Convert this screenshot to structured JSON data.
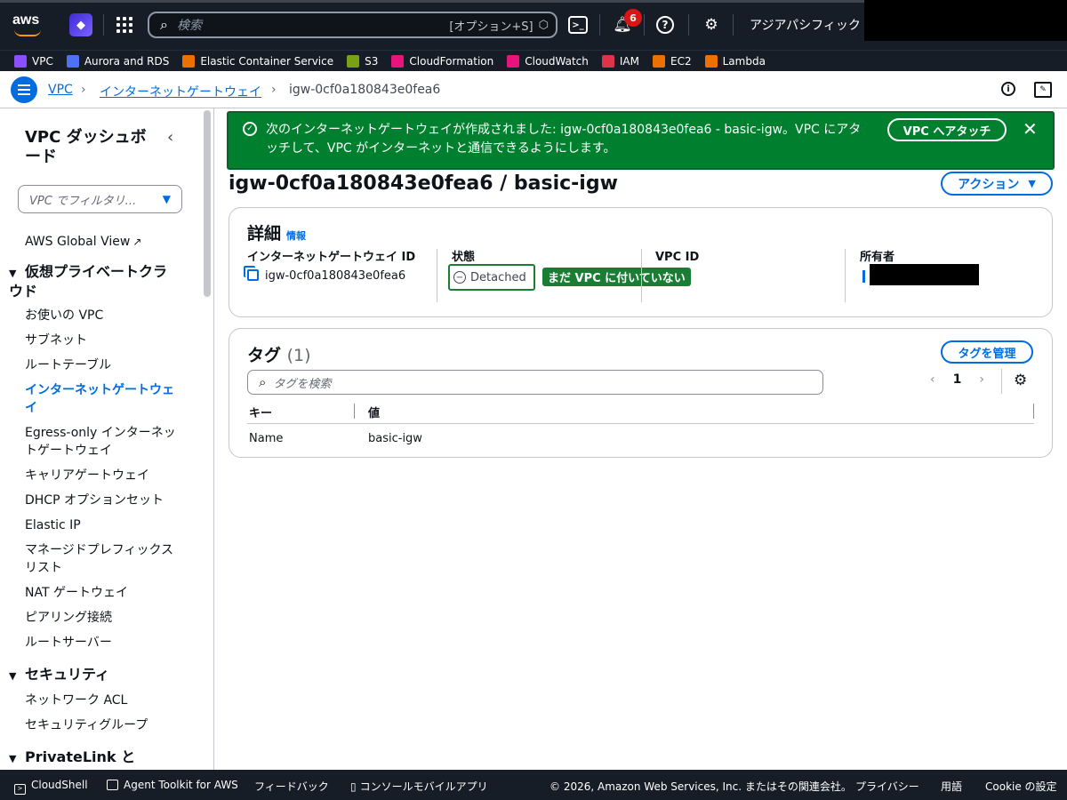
{
  "topnav": {
    "logo": "aws",
    "search_placeholder": "検索",
    "search_shortcut": "[オプション+S]",
    "notification_count": "6",
    "region": "アジアパシフィック (東京)"
  },
  "favorites": [
    {
      "label": "VPC",
      "color": "#8c4fff"
    },
    {
      "label": "Aurora and RDS",
      "color": "#4d72f3"
    },
    {
      "label": "Elastic Container Service",
      "color": "#ed7100"
    },
    {
      "label": "S3",
      "color": "#7aa116"
    },
    {
      "label": "CloudFormation",
      "color": "#e7157b"
    },
    {
      "label": "CloudWatch",
      "color": "#e7157b"
    },
    {
      "label": "IAM",
      "color": "#dd344c"
    },
    {
      "label": "EC2",
      "color": "#ed7100"
    },
    {
      "label": "Lambda",
      "color": "#ed7100"
    }
  ],
  "breadcrumb": {
    "items": [
      "VPC",
      "インターネットゲートウェイ"
    ],
    "current": "igw-0cf0a180843e0fea6"
  },
  "sidebar": {
    "title": "VPC ダッシュボード",
    "filter_placeholder": "VPC でフィルタリ...",
    "global_view": "AWS Global View",
    "section_vpc": "仮想プライベートクラウド",
    "vpc_items": [
      "お使いの VPC",
      "サブネット",
      "ルートテーブル",
      "インターネットゲートウェイ",
      "Egress-only インターネットゲートウェイ",
      "キャリアゲートウェイ",
      "DHCP オプションセット",
      "Elastic IP",
      "マネージドプレフィックスリスト",
      "NAT ゲートウェイ",
      "ピアリング接続",
      "ルートサーバー"
    ],
    "section_security": "セキュリティ",
    "security_items": [
      "ネットワーク ACL",
      "セキュリティグループ"
    ],
    "section_privatelink": "PrivateLink と Lattice"
  },
  "flash": {
    "message": "次のインターネットゲートウェイが作成されました: igw-0cf0a180843e0fea6 - basic-igw。VPC にアタッチして、VPC がインターネットと通信できるようにします。",
    "attach_button": "VPC へアタッチ"
  },
  "page": {
    "title": "igw-0cf0a180843e0fea6 / basic-igw",
    "actions_button": "アクション"
  },
  "details": {
    "heading": "詳細",
    "info_link": "情報",
    "igw_id_label": "インターネットゲートウェイ ID",
    "igw_id_value": "igw-0cf0a180843e0fea6",
    "state_label": "状態",
    "state_value": "Detached",
    "state_annotation": "まだ VPC に付いていない",
    "vpc_id_label": "VPC ID",
    "owner_label": "所有者"
  },
  "tags": {
    "heading": "タグ",
    "count": "(1)",
    "manage_button": "タグを管理",
    "search_placeholder": "タグを検索",
    "page": "1",
    "col_key": "キー",
    "col_value": "値",
    "rows": [
      {
        "key": "Name",
        "value": "basic-igw"
      }
    ]
  },
  "footer": {
    "cloudshell": "CloudShell",
    "agent_toolkit": "Agent Toolkit for AWS",
    "feedback": "フィードバック",
    "mobile_app": "コンソールモバイルアプリ",
    "copyright": "© 2026, Amazon Web Services, Inc. またはその関連会社。",
    "privacy": "プライバシー",
    "terms": "用語",
    "cookie": "Cookie の設定"
  }
}
